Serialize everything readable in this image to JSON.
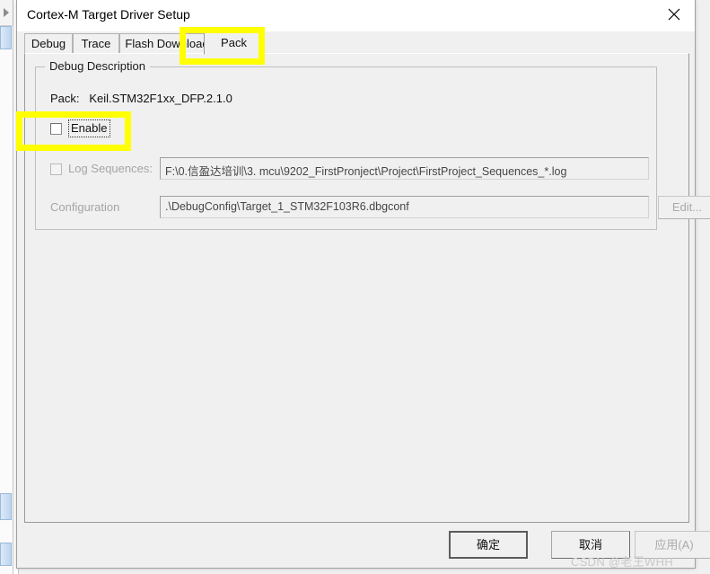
{
  "window": {
    "title": "Cortex-M Target Driver Setup",
    "close_icon": "close-icon"
  },
  "tabs": [
    {
      "label": "Debug",
      "selected": false
    },
    {
      "label": "Trace",
      "selected": false
    },
    {
      "label": "Flash Download",
      "selected": false
    },
    {
      "label": "Pack",
      "selected": true
    }
  ],
  "debug_description": {
    "group_title": "Debug Description",
    "pack_label": "Pack:",
    "pack_value": "Keil.STM32F1xx_DFP.2.1.0",
    "enable": {
      "label": "Enable",
      "checked": false
    },
    "log_sequences": {
      "label": "Log Sequences:",
      "checked": false,
      "value": "F:\\0.信盈达培训\\3. mcu\\9202_FirstPronject\\Project\\FirstProject_Sequences_*.log"
    },
    "configuration": {
      "label": "Configuration",
      "value": ".\\DebugConfig\\Target_1_STM32F103R6.dbgconf",
      "edit_label": "Edit..."
    }
  },
  "footer": {
    "ok_label": "确定",
    "cancel_label": "取消",
    "apply_label": "应用(A)"
  },
  "watermark": "CSDN @老王WHH",
  "colors": {
    "highlight": "#ffff00",
    "dialog_bg": "#f0f0f0",
    "titlebar_bg": "#ffffff",
    "disabled_text": "#a5a5a5"
  }
}
